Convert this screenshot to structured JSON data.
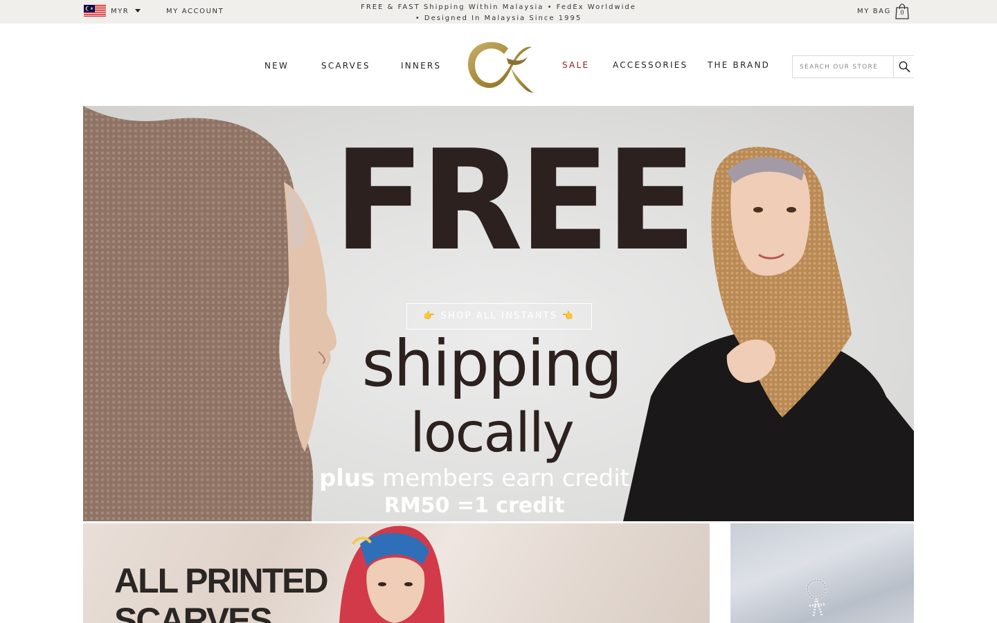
{
  "topbar": {
    "flag_icon": "malaysia-flag-icon",
    "currency": "MYR",
    "my_account": "MY ACCOUNT",
    "promo_line1": "FREE & FAST Shipping Within Malaysia • FedEx Worldwide",
    "promo_line2": "• Designed In Malaysia Since 1995",
    "my_bag": "MY BAG",
    "bag_count": "0"
  },
  "nav": {
    "items": [
      {
        "label": "NEW"
      },
      {
        "label": "SCARVES"
      },
      {
        "label": "INNERS"
      },
      {
        "label": "SALE"
      },
      {
        "label": "ACCESSORIES"
      },
      {
        "label": "THE BRAND"
      }
    ],
    "search_placeholder": "SEARCH OUR STORE",
    "sale_color": "#8b1a1a"
  },
  "hero": {
    "headline": "FREE",
    "cta": "👉 SHOP ALL INSTANTS 👈",
    "line2": "shipping",
    "line3": "locally",
    "plus_bold": "plus",
    "plus_rest": " members earn credit",
    "credit_rate": "RM50 =1 credit"
  },
  "tiles": {
    "printed_line1": "ALL PRINTED",
    "printed_line2": "SCARVES"
  },
  "colors": {
    "topbar_bg": "#f1efec",
    "logo_gold": "#a88b3c",
    "headline_text": "#2c211e"
  }
}
